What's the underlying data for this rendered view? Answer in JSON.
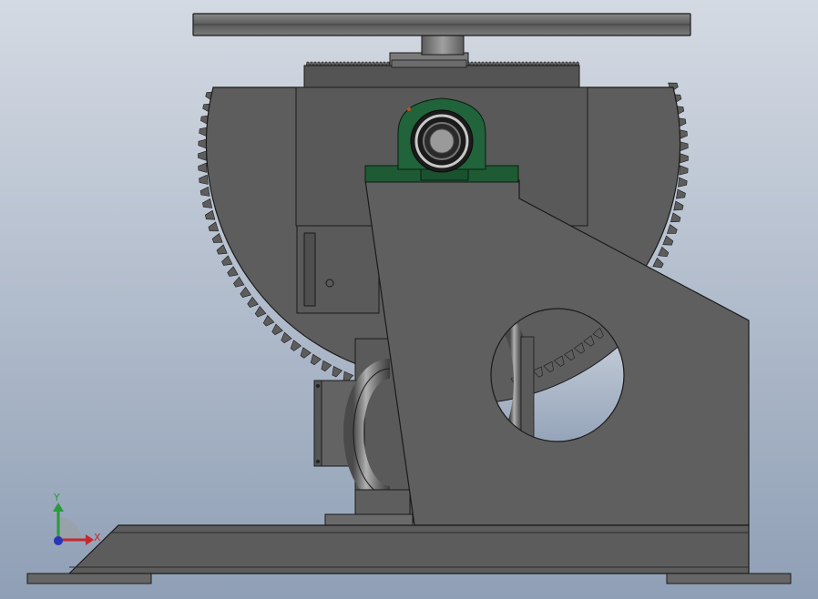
{
  "background": {
    "top": "#d4dae3",
    "bottom": "#8f9fb5"
  },
  "colors": {
    "steel": "#5c5c5c",
    "steel_light": "#7a7a7a",
    "steel_dark": "#474747",
    "outline": "#1a1a1a",
    "bearing_green": "#1e5a34",
    "axis_x": "#c8282d",
    "axis_y": "#2a9a3a",
    "axis_z": "#2836b8"
  },
  "triad": {
    "x_label": "X",
    "y_label": "Y"
  }
}
